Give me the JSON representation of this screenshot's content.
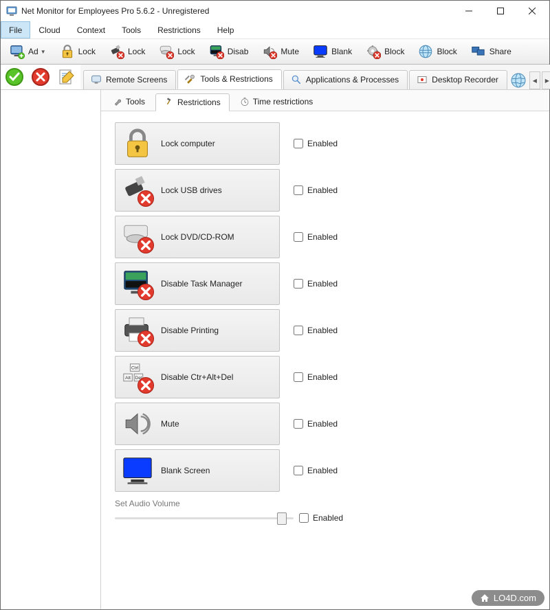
{
  "title": "Net Monitor for Employees Pro 5.6.2 - Unregistered",
  "menu": [
    "File",
    "Cloud",
    "Context",
    "Tools",
    "Restrictions",
    "Help"
  ],
  "menu_selected": 0,
  "toolbar": [
    {
      "label": "Ad",
      "icon": "monitor-add",
      "chev": true
    },
    {
      "label": "Lock",
      "icon": "padlock"
    },
    {
      "label": "Lock",
      "icon": "usb-x"
    },
    {
      "label": "Lock",
      "icon": "disc-x"
    },
    {
      "label": "Disab",
      "icon": "screen-x"
    },
    {
      "label": "Mute",
      "icon": "speaker-x"
    },
    {
      "label": "Blank",
      "icon": "monitor-blue"
    },
    {
      "label": "Block",
      "icon": "gear-x"
    },
    {
      "label": "Block",
      "icon": "globe"
    },
    {
      "label": "Share",
      "icon": "desktops"
    }
  ],
  "main_tabs": [
    {
      "label": "Remote Screens",
      "icon": "monitor"
    },
    {
      "label": "Tools & Restrictions",
      "icon": "tools",
      "active": true
    },
    {
      "label": "Applications & Processes",
      "icon": "magnifier"
    },
    {
      "label": "Desktop Recorder",
      "icon": "recorder"
    }
  ],
  "subtabs": [
    {
      "label": "Tools",
      "icon": "wrench"
    },
    {
      "label": "Restrictions",
      "icon": "hammer",
      "active": true
    },
    {
      "label": "Time restrictions",
      "icon": "clock"
    }
  ],
  "restrictions": [
    {
      "label": "Lock computer",
      "icon": "padlock",
      "enabled_label": "Enabled"
    },
    {
      "label": "Lock USB drives",
      "icon": "usb-x",
      "enabled_label": "Enabled"
    },
    {
      "label": "Lock DVD/CD-ROM",
      "icon": "disc-x",
      "enabled_label": "Enabled"
    },
    {
      "label": "Disable Task Manager",
      "icon": "taskmgr-x",
      "enabled_label": "Enabled"
    },
    {
      "label": "Disable Printing",
      "icon": "printer-x",
      "enabled_label": "Enabled"
    },
    {
      "label": "Disable Ctr+Alt+Del",
      "icon": "keys-x",
      "enabled_label": "Enabled"
    },
    {
      "label": "Mute",
      "icon": "speaker",
      "enabled_label": "Enabled"
    },
    {
      "label": "Blank Screen",
      "icon": "monitor-blue",
      "enabled_label": "Enabled"
    }
  ],
  "audio": {
    "label": "Set Audio Volume",
    "slider_value": 95,
    "enabled_label": "Enabled"
  },
  "watermark": "LO4D.com"
}
